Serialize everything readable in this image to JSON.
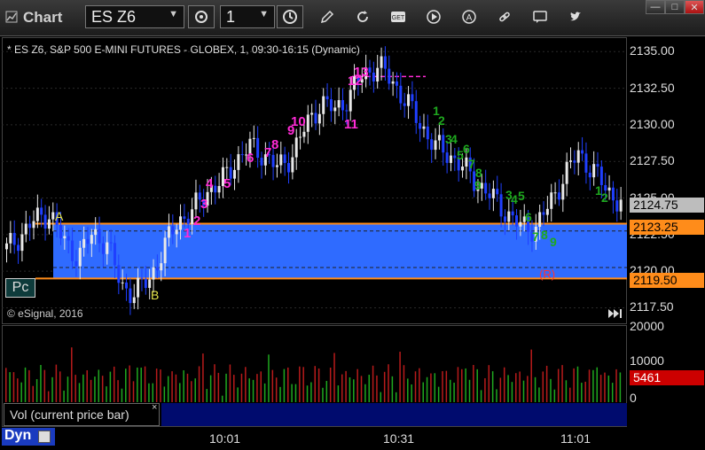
{
  "app": {
    "title": "Chart"
  },
  "toolbar": {
    "symbol": "ES Z6",
    "interval": "1",
    "icons": [
      "settings-gear-icon",
      "clock-icon",
      "pencil-draw-icon",
      "refresh-icon",
      "get-data-icon",
      "play-icon",
      "alert-icon",
      "link-icon",
      "comment-icon",
      "twitter-icon"
    ]
  },
  "window": {
    "min": "—",
    "max": "□",
    "close": "✕"
  },
  "chart": {
    "info": "* ES Z6, S&P 500 E-MINI FUTURES - GLOBEX, 1, 09:30-16:15 (Dynamic)",
    "copyright": "© eSignal, 2016",
    "pc_label": "Pc",
    "label_a": "A",
    "label_b": "B",
    "r_label": "(R)",
    "price_ticks": [
      "2135.00",
      "2132.50",
      "2130.00",
      "2127.50",
      "2125.00",
      "2122.50",
      "2120.00",
      "2117.50"
    ],
    "tags": {
      "gray": "2124.75",
      "orange1": "2123.25",
      "orange2": "2119.50"
    },
    "colors": {
      "band": "#2f6bff",
      "orange": "#ff8c1a",
      "magenta": "#ff2bd6",
      "green": "#1fa81f",
      "up": "#e8e8e8",
      "down": "#1f3fff"
    }
  },
  "chart_data": {
    "type": "line",
    "title": "* ES Z6, S&P 500 E-MINI FUTURES - GLOBEX, 1, 09:30-16:15 (Dynamic)",
    "x": [
      "10:01",
      "10:31",
      "11:01"
    ],
    "ylim": [
      2116.5,
      2135.5
    ],
    "y_ticks": [
      2117.5,
      2120.0,
      2122.5,
      2125.0,
      2127.5,
      2130.0,
      2132.5,
      2135.0
    ],
    "series": [
      {
        "values": [
          2121.5,
          2122.5,
          2123.5,
          2124.0,
          2122.0,
          2121.0,
          2122.5,
          2122.0,
          2119.0,
          2118.5,
          2119.5,
          2121.5,
          2123.5,
          2124.0,
          2125.5,
          2126.0,
          2127.5,
          2128.5,
          2128.0,
          2127.0,
          2128.0,
          2130.0,
          2131.5,
          2131.0,
          2132.0,
          2133.5,
          2134.0,
          2133.0,
          2131.5,
          2130.0,
          2128.5,
          2128.0,
          2127.0,
          2126.0,
          2125.0,
          2124.0,
          2123.0,
          2123.0,
          2124.5,
          2126.5,
          2128.0,
          2127.0,
          2125.5,
          2124.75
        ]
      }
    ],
    "levels": {
      "upper": 2123.25,
      "lower": 2119.5,
      "last": 2124.75
    },
    "volume": {
      "last": 5461,
      "ticks": [
        20000,
        10000,
        0
      ]
    }
  },
  "legend": {
    "label": "Vol (current price bar)",
    "close": "×",
    "value": "5461"
  },
  "xaxis": {
    "ticks": [
      "10:01",
      "10:31",
      "11:01"
    ]
  },
  "footer": {
    "mode": "Dyn"
  },
  "counts": {
    "magenta": [
      "1",
      "2",
      "3",
      "4",
      "5",
      "6",
      "7",
      "8",
      "9",
      "10",
      "11",
      "12",
      "13"
    ],
    "green": [
      "1",
      "2",
      "3",
      "4",
      "5",
      "6",
      "7",
      "8",
      "9",
      "1",
      "2",
      "3",
      "4",
      "5",
      "6",
      "7",
      "8",
      "9"
    ]
  }
}
